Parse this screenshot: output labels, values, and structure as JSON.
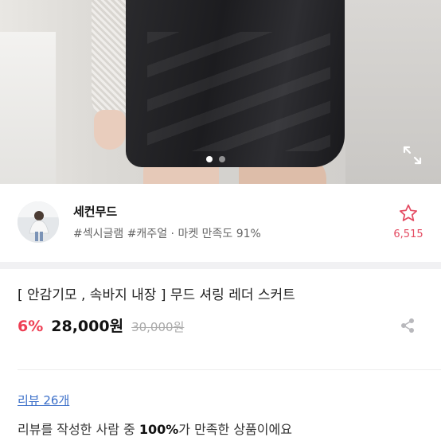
{
  "gallery": {
    "image_alt": "",
    "slide_count": 2,
    "active_slide": 1,
    "expand_icon": "expand-arrows-icon"
  },
  "seller": {
    "name": "세컨무드",
    "tags": "#섹시글램 #캐주얼",
    "separator": "·",
    "satisfaction": "마켓 만족도 91%",
    "favorite_count": "6,515",
    "favorite_icon": "star-outline-icon",
    "accent_color": "#e44b62"
  },
  "product": {
    "title": "[ 안감기모 , 속바지 내장 ] 무드 셔링 레더 스커트",
    "discount": "6%",
    "price": "28,000원",
    "original_price": "30,000원",
    "discount_color": "#ee3f54",
    "share_icon": "share-icon"
  },
  "reviews": {
    "link_label": "리뷰 26개",
    "summary_prefix": "리뷰를 작성한 사람 중 ",
    "summary_percent": "100%",
    "summary_suffix": "가 만족한 상품이에요"
  }
}
